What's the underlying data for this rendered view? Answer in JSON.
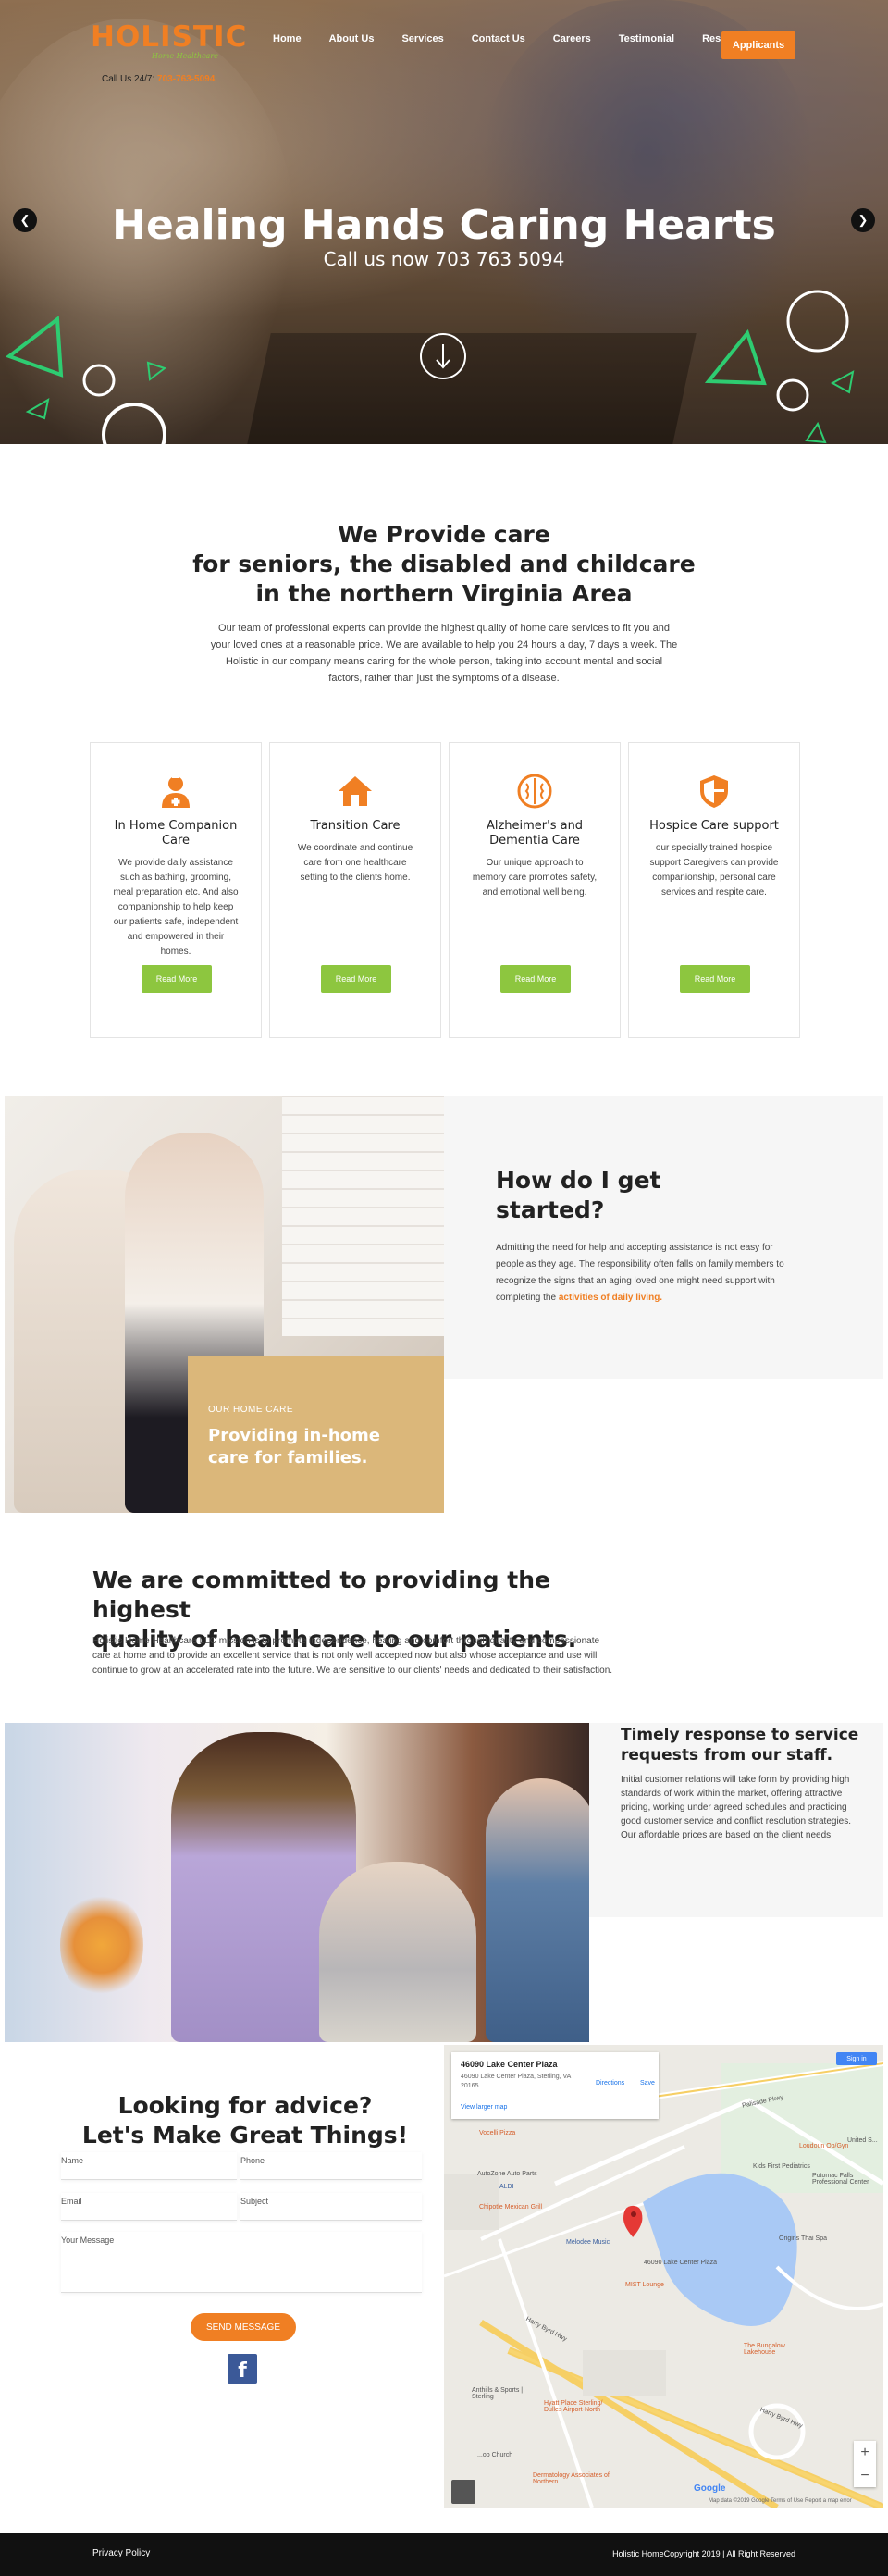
{
  "brand": {
    "logo_word": "HOLISTIC",
    "logo_sub": "Home Healthcare",
    "call_prefix": "Call Us 24/7:",
    "call_number": "703-763-5094",
    "accent": "#f07f23",
    "green": "#8dc63f"
  },
  "nav": {
    "items": [
      "Home",
      "About Us",
      "Services",
      "Contact Us",
      "Careers",
      "Testimonial",
      "Resource"
    ],
    "cta": "Applicants"
  },
  "hero": {
    "title": "Healing Hands Caring Hearts",
    "subtitle": "Call us now 703 763 5094",
    "prev_icon": "chevron-left-icon",
    "next_icon": "chevron-right-icon"
  },
  "provide": {
    "title_lines": [
      "We Provide care",
      "for seniors, the disabled and childcare",
      "in the northern Virginia Area"
    ],
    "text": "Our team of professional experts can provide the highest quality of home care services to fit you and your loved ones at a reasonable price. We are available to help you 24 hours a day, 7 days a week. The Holistic in our company means caring for the whole person, taking into account mental and social factors, rather than just the symptoms of a disease."
  },
  "services": [
    {
      "icon": "nurse-icon",
      "title": "In Home Companion Care",
      "text": "We provide daily assistance such as bathing, grooming, meal preparation etc. And also companionship to help keep our patients safe, independent and empowered in their homes.",
      "button": "Read More"
    },
    {
      "icon": "home-icon",
      "title": "Transition Care",
      "text": "We coordinate and continue care from one healthcare setting to the clients home.",
      "button": "Read More"
    },
    {
      "icon": "brain-icon",
      "title": "Alzheimer's and Dementia Care",
      "text": "Our unique approach to memory care promotes safety, and emotional well being.",
      "button": "Read More"
    },
    {
      "icon": "shield-icon",
      "title": "Hospice Care support",
      "text": "our specially trained hospice support Caregivers can provide companionship, personal care services and respite care.",
      "button": "Read More"
    }
  ],
  "started": {
    "title_lines": [
      "How do I get",
      "started?"
    ],
    "text": "Admitting the need for help and accepting assistance is not easy for people as they age. The responsibility often falls on family members to recognize the signs that an aging loved one might need support with completing the ",
    "highlight": "activities of daily living.",
    "kicker": "OUR HOME CARE",
    "box_lines": [
      "Providing in-home",
      "care for families."
    ]
  },
  "committed": {
    "title_lines": [
      "We are committed to providing the highest",
      "quality of healthcare to our patients."
    ],
    "text": "Holistic Home Healthcare LLC mission is to promote independence, healing and comfort through quality and compassionate care at home and to provide an excellent service that is not only well accepted now but also whose acceptance and use will continue to grow at an accelerated rate into the future. We are sensitive to our clients' needs and dedicated to their satisfaction."
  },
  "timely": {
    "title_lines": [
      "Timely response to service",
      "requests from our staff."
    ],
    "text": "Initial customer relations will take form by providing high standards of work within the market, offering attractive pricing, working under agreed schedules and practicing good customer service and conflict resolution strategies. Our affordable prices are based on the client needs."
  },
  "contact": {
    "title_lines": [
      "Looking for advice?",
      "Let's Make Great Things!"
    ],
    "name_ph": "Name",
    "phone_ph": "Phone",
    "email_ph": "Email",
    "subject_ph": "Subject",
    "message_ph": "Your Message",
    "send": "SEND MESSAGE",
    "fb": "f"
  },
  "map": {
    "place": "46090 Lake Center Plaza",
    "address": "46090 Lake Center Plaza, Sterling, VA 20165",
    "larger": "View larger map",
    "directions": "Directions",
    "save": "Save",
    "signin": "Sign in",
    "pin_label": "46090 Lake Center Plaza",
    "labels": {
      "vocelli": "Vocelli Pizza",
      "united": "United S...",
      "palisade": "Palisade Pkwy",
      "loudoun": "Loudoun Ob/Gyn",
      "kids": "Kids First Pediatrics",
      "potomac": "Potomac Falls Professional Center",
      "autozone": "AutoZone Auto Parts",
      "aldi": "ALDI",
      "chipotle": "Chipotle Mexican Grill",
      "melodee": "Melodee Music",
      "origins": "Origins Thai Spa",
      "mist": "MIST Lounge",
      "bungalow": "The Bungalow Lakehouse",
      "harry1": "Harry Byrd Hwy",
      "harry2": "Harry Byrd Hwy",
      "anthills": "Anthills & Sports | Sterling",
      "hyatt": "Hyatt Place Sterling/ Dulles Airport-North",
      "church": "...op Church",
      "derm": "Dermatology Associates of Northern...",
      "google": "Google",
      "foot": "Map data ©2019 Google   Terms of Use   Report a map error"
    }
  },
  "footer": {
    "privacy": "Privacy Policy",
    "copyright": "Holistic HomeCopyright 2019 | All Right Reserved"
  }
}
